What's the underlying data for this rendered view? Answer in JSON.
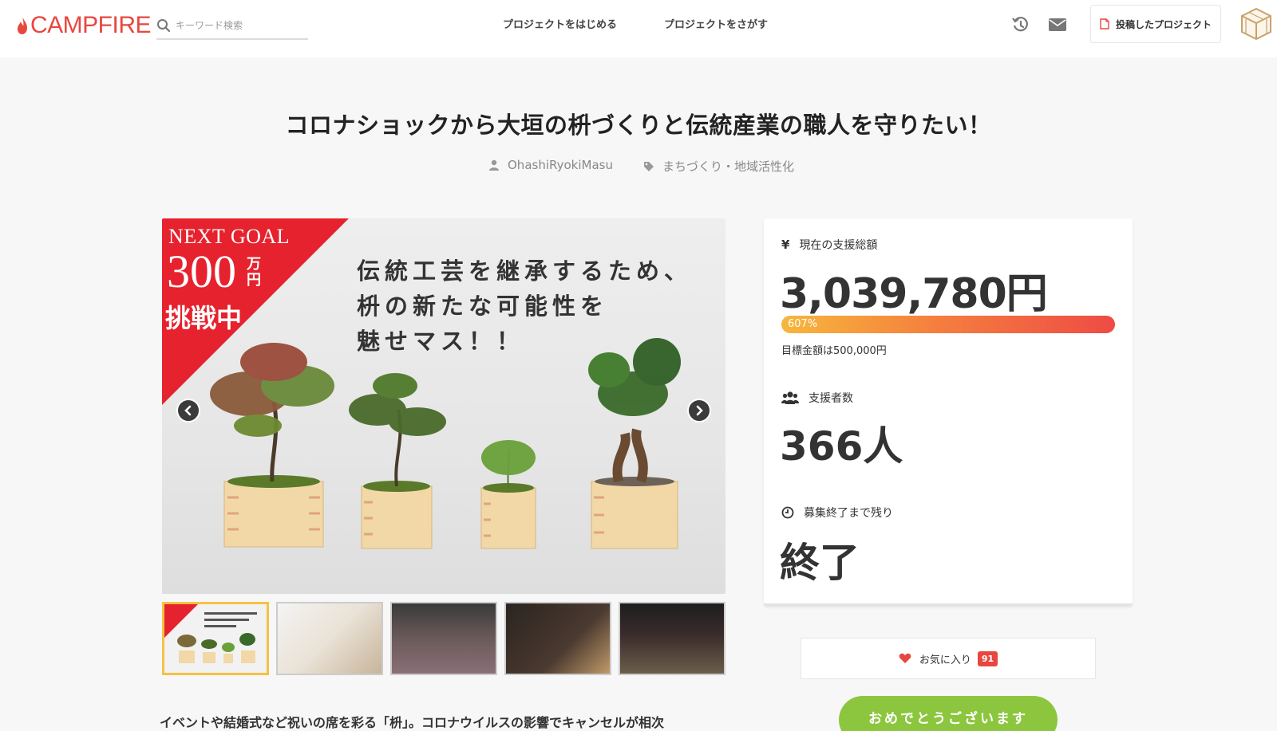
{
  "header": {
    "logo_text": "CAMPFIRE",
    "search_placeholder": "キーワード検索",
    "nav_start": "プロジェクトをはじめる",
    "nav_find": "プロジェクトをさがす",
    "posted_projects": "投稿したプロジェクト",
    "icons": [
      "history-icon",
      "mail-icon",
      "document-icon",
      "avatar-box-icon"
    ]
  },
  "project": {
    "title": "コロナショックから大垣の枡づくりと伝統産業の職人を守りたい！",
    "owner": "OhashiRyokiMasu",
    "category": "まちづくり・地域活性化"
  },
  "hero": {
    "goal_line1": "NEXT GOAL",
    "goal_amount": "300",
    "goal_unit1": "万",
    "goal_unit2": "円",
    "goal_line3": "挑戦中",
    "slogan_line1": "伝統工芸を継承するため、",
    "slogan_line2": "枡の新たな可能性を",
    "slogan_line3": "魅せマス！！"
  },
  "thumbnails": [
    {
      "name": "thumb-1"
    },
    {
      "name": "thumb-2"
    },
    {
      "name": "thumb-3"
    },
    {
      "name": "thumb-4"
    },
    {
      "name": "thumb-5"
    }
  ],
  "stats": {
    "amount_label": "現在の支援総額",
    "amount_value": "3,039,780円",
    "progress_percent": "607%",
    "progress_fraction": 1.0,
    "goal_text": "目標金額は500,000円",
    "backers_label": "支援者数",
    "backers_value": "366人",
    "remain_label": "募集終了まで残り",
    "remain_value": "終了"
  },
  "actions": {
    "favorite_label": "お気に入り",
    "favorite_count": "91",
    "congrats_label": "おめでとうございます"
  },
  "intro": "イベントや結婚式など祝いの席を彩る「枡」。コロナウイルスの影響でキャンセルが相次",
  "colors": {
    "brand": "#e8473f",
    "progress_start": "#f6b73c",
    "progress_end": "#ee4b45",
    "congrats_green": "#8cc63f",
    "active_thumb": "#f5c242"
  }
}
